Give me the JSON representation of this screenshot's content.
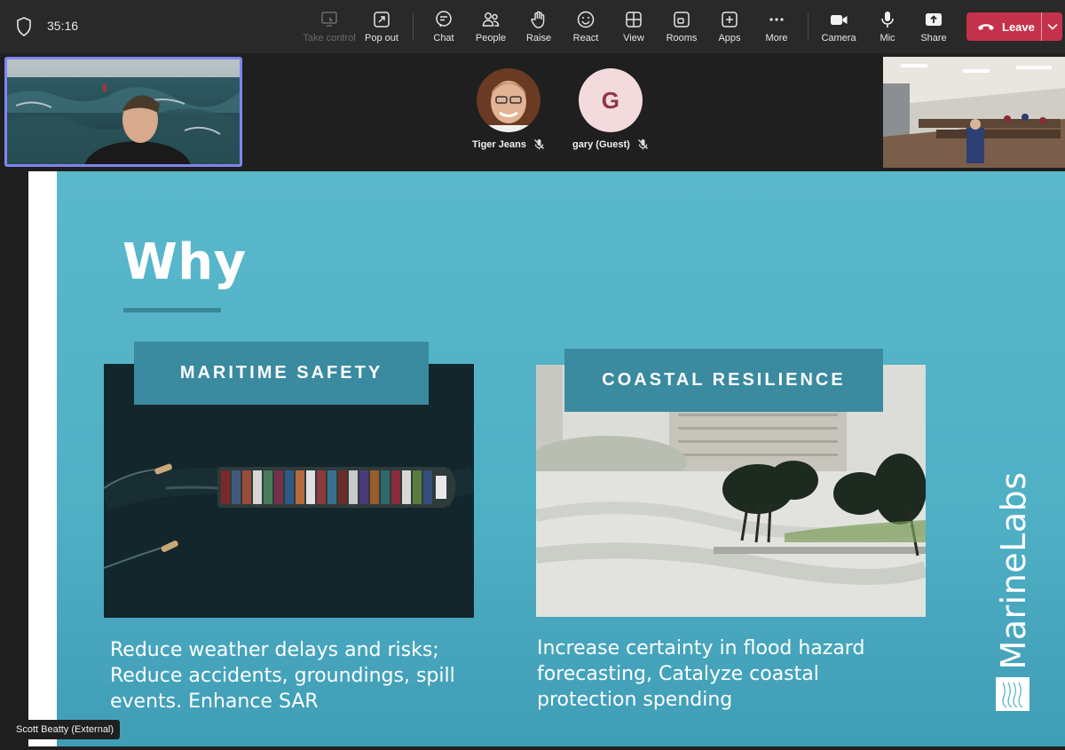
{
  "meeting": {
    "timer": "35:16"
  },
  "toolbar": {
    "take_control": "Take control",
    "pop_out": "Pop out",
    "chat": "Chat",
    "people": "People",
    "raise": "Raise",
    "react": "React",
    "view": "View",
    "rooms": "Rooms",
    "apps": "Apps",
    "more": "More",
    "camera": "Camera",
    "mic": "Mic",
    "share": "Share",
    "leave": "Leave"
  },
  "participants": [
    {
      "name": "Tiger Jeans",
      "muted": true
    },
    {
      "name": "gary (Guest)",
      "initial": "G",
      "muted": true
    }
  ],
  "presenter": {
    "name": "Scott Beatty (External)"
  },
  "slide": {
    "title": "Why",
    "cards": [
      {
        "label": "MARITIME SAFETY",
        "text": "Reduce weather delays and risks; Reduce accidents, groundings, spill events. Enhance SAR"
      },
      {
        "label": "COASTAL RESILIENCE",
        "text": "Increase certainty in flood hazard forecasting, Catalyze coastal protection spending"
      }
    ],
    "brand": "MarineLabs"
  },
  "colors": {
    "toolbar_bg": "#292929",
    "leave_red": "#c4314b",
    "slide_teal": "#53b3c7",
    "label_box": "#3a8aa0",
    "self_tile_border": "#7f85f5"
  }
}
